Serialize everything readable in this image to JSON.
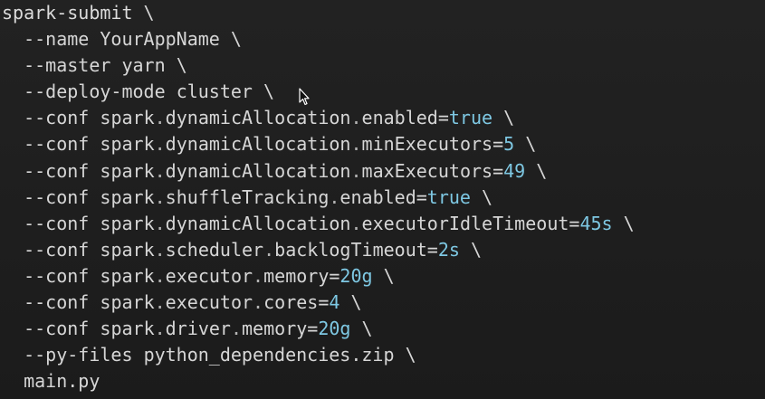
{
  "editor": {
    "lines": [
      {
        "prefix": "spark-submit",
        "cont": "\\"
      },
      {
        "indent": "  ",
        "flag": "--name",
        "arg": "YourAppName",
        "cont": "\\"
      },
      {
        "indent": "  ",
        "flag": "--master",
        "arg": "yarn",
        "cont": "\\"
      },
      {
        "indent": "  ",
        "flag": "--deploy-mode",
        "arg": "cluster",
        "cont": "\\"
      },
      {
        "indent": "  ",
        "flag": "--conf",
        "key": "spark.dynamicAllocation.enabled",
        "eq": "=",
        "value": "true",
        "cont": "\\"
      },
      {
        "indent": "  ",
        "flag": "--conf",
        "key": "spark.dynamicAllocation.minExecutors",
        "eq": "=",
        "value": "5",
        "cont": "\\"
      },
      {
        "indent": "  ",
        "flag": "--conf",
        "key": "spark.dynamicAllocation.maxExecutors",
        "eq": "=",
        "value": "49",
        "cont": "\\"
      },
      {
        "indent": "  ",
        "flag": "--conf",
        "key": "spark.shuffleTracking.enabled",
        "eq": "=",
        "value": "true",
        "cont": "\\"
      },
      {
        "indent": "  ",
        "flag": "--conf",
        "key": "spark.dynamicAllocation.executorIdleTimeout",
        "eq": "=",
        "value": "45s",
        "cont": "\\"
      },
      {
        "indent": "  ",
        "flag": "--conf",
        "key": "spark.scheduler.backlogTimeout",
        "eq": "=",
        "value": "2s",
        "cont": "\\"
      },
      {
        "indent": "  ",
        "flag": "--conf",
        "key": "spark.executor.memory",
        "eq": "=",
        "value": "20g",
        "cont": "\\"
      },
      {
        "indent": "  ",
        "flag": "--conf",
        "key": "spark.executor.cores",
        "eq": "=",
        "value": "4",
        "cont": "\\"
      },
      {
        "indent": "  ",
        "flag": "--conf",
        "key": "spark.driver.memory",
        "eq": "=",
        "value": "20g",
        "cont": "\\"
      },
      {
        "indent": "  ",
        "flag": "--py-files",
        "arg": "python_dependencies.zip",
        "cont": "\\"
      },
      {
        "indent": "  ",
        "arg": "main.py"
      }
    ]
  },
  "colors": {
    "background": "#1e1e1e",
    "text": "#d6d6d6",
    "value": "#7ec8e3"
  },
  "cursor": {
    "icon": "mouse-pointer-icon"
  }
}
